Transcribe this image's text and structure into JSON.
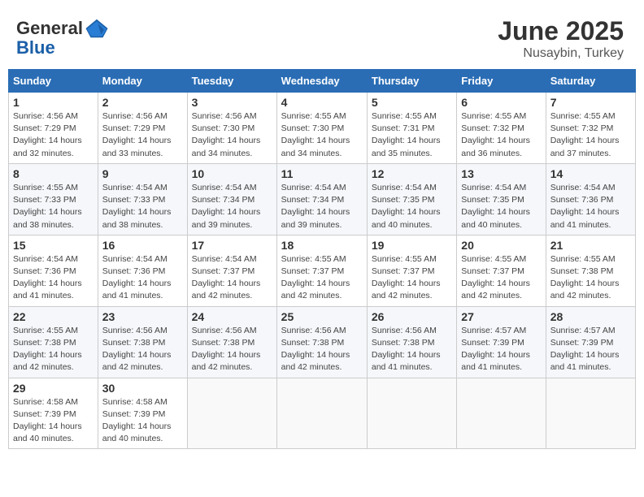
{
  "header": {
    "logo_line1": "General",
    "logo_line2": "Blue",
    "title": "June 2025",
    "location": "Nusaybin, Turkey"
  },
  "calendar": {
    "days_of_week": [
      "Sunday",
      "Monday",
      "Tuesday",
      "Wednesday",
      "Thursday",
      "Friday",
      "Saturday"
    ],
    "weeks": [
      [
        {
          "day": "1",
          "info": "Sunrise: 4:56 AM\nSunset: 7:29 PM\nDaylight: 14 hours\nand 32 minutes."
        },
        {
          "day": "2",
          "info": "Sunrise: 4:56 AM\nSunset: 7:29 PM\nDaylight: 14 hours\nand 33 minutes."
        },
        {
          "day": "3",
          "info": "Sunrise: 4:56 AM\nSunset: 7:30 PM\nDaylight: 14 hours\nand 34 minutes."
        },
        {
          "day": "4",
          "info": "Sunrise: 4:55 AM\nSunset: 7:30 PM\nDaylight: 14 hours\nand 34 minutes."
        },
        {
          "day": "5",
          "info": "Sunrise: 4:55 AM\nSunset: 7:31 PM\nDaylight: 14 hours\nand 35 minutes."
        },
        {
          "day": "6",
          "info": "Sunrise: 4:55 AM\nSunset: 7:32 PM\nDaylight: 14 hours\nand 36 minutes."
        },
        {
          "day": "7",
          "info": "Sunrise: 4:55 AM\nSunset: 7:32 PM\nDaylight: 14 hours\nand 37 minutes."
        }
      ],
      [
        {
          "day": "8",
          "info": "Sunrise: 4:55 AM\nSunset: 7:33 PM\nDaylight: 14 hours\nand 38 minutes."
        },
        {
          "day": "9",
          "info": "Sunrise: 4:54 AM\nSunset: 7:33 PM\nDaylight: 14 hours\nand 38 minutes."
        },
        {
          "day": "10",
          "info": "Sunrise: 4:54 AM\nSunset: 7:34 PM\nDaylight: 14 hours\nand 39 minutes."
        },
        {
          "day": "11",
          "info": "Sunrise: 4:54 AM\nSunset: 7:34 PM\nDaylight: 14 hours\nand 39 minutes."
        },
        {
          "day": "12",
          "info": "Sunrise: 4:54 AM\nSunset: 7:35 PM\nDaylight: 14 hours\nand 40 minutes."
        },
        {
          "day": "13",
          "info": "Sunrise: 4:54 AM\nSunset: 7:35 PM\nDaylight: 14 hours\nand 40 minutes."
        },
        {
          "day": "14",
          "info": "Sunrise: 4:54 AM\nSunset: 7:36 PM\nDaylight: 14 hours\nand 41 minutes."
        }
      ],
      [
        {
          "day": "15",
          "info": "Sunrise: 4:54 AM\nSunset: 7:36 PM\nDaylight: 14 hours\nand 41 minutes."
        },
        {
          "day": "16",
          "info": "Sunrise: 4:54 AM\nSunset: 7:36 PM\nDaylight: 14 hours\nand 41 minutes."
        },
        {
          "day": "17",
          "info": "Sunrise: 4:54 AM\nSunset: 7:37 PM\nDaylight: 14 hours\nand 42 minutes."
        },
        {
          "day": "18",
          "info": "Sunrise: 4:55 AM\nSunset: 7:37 PM\nDaylight: 14 hours\nand 42 minutes."
        },
        {
          "day": "19",
          "info": "Sunrise: 4:55 AM\nSunset: 7:37 PM\nDaylight: 14 hours\nand 42 minutes."
        },
        {
          "day": "20",
          "info": "Sunrise: 4:55 AM\nSunset: 7:37 PM\nDaylight: 14 hours\nand 42 minutes."
        },
        {
          "day": "21",
          "info": "Sunrise: 4:55 AM\nSunset: 7:38 PM\nDaylight: 14 hours\nand 42 minutes."
        }
      ],
      [
        {
          "day": "22",
          "info": "Sunrise: 4:55 AM\nSunset: 7:38 PM\nDaylight: 14 hours\nand 42 minutes."
        },
        {
          "day": "23",
          "info": "Sunrise: 4:56 AM\nSunset: 7:38 PM\nDaylight: 14 hours\nand 42 minutes."
        },
        {
          "day": "24",
          "info": "Sunrise: 4:56 AM\nSunset: 7:38 PM\nDaylight: 14 hours\nand 42 minutes."
        },
        {
          "day": "25",
          "info": "Sunrise: 4:56 AM\nSunset: 7:38 PM\nDaylight: 14 hours\nand 42 minutes."
        },
        {
          "day": "26",
          "info": "Sunrise: 4:56 AM\nSunset: 7:38 PM\nDaylight: 14 hours\nand 41 minutes."
        },
        {
          "day": "27",
          "info": "Sunrise: 4:57 AM\nSunset: 7:39 PM\nDaylight: 14 hours\nand 41 minutes."
        },
        {
          "day": "28",
          "info": "Sunrise: 4:57 AM\nSunset: 7:39 PM\nDaylight: 14 hours\nand 41 minutes."
        }
      ],
      [
        {
          "day": "29",
          "info": "Sunrise: 4:58 AM\nSunset: 7:39 PM\nDaylight: 14 hours\nand 40 minutes."
        },
        {
          "day": "30",
          "info": "Sunrise: 4:58 AM\nSunset: 7:39 PM\nDaylight: 14 hours\nand 40 minutes."
        },
        null,
        null,
        null,
        null,
        null
      ]
    ]
  }
}
